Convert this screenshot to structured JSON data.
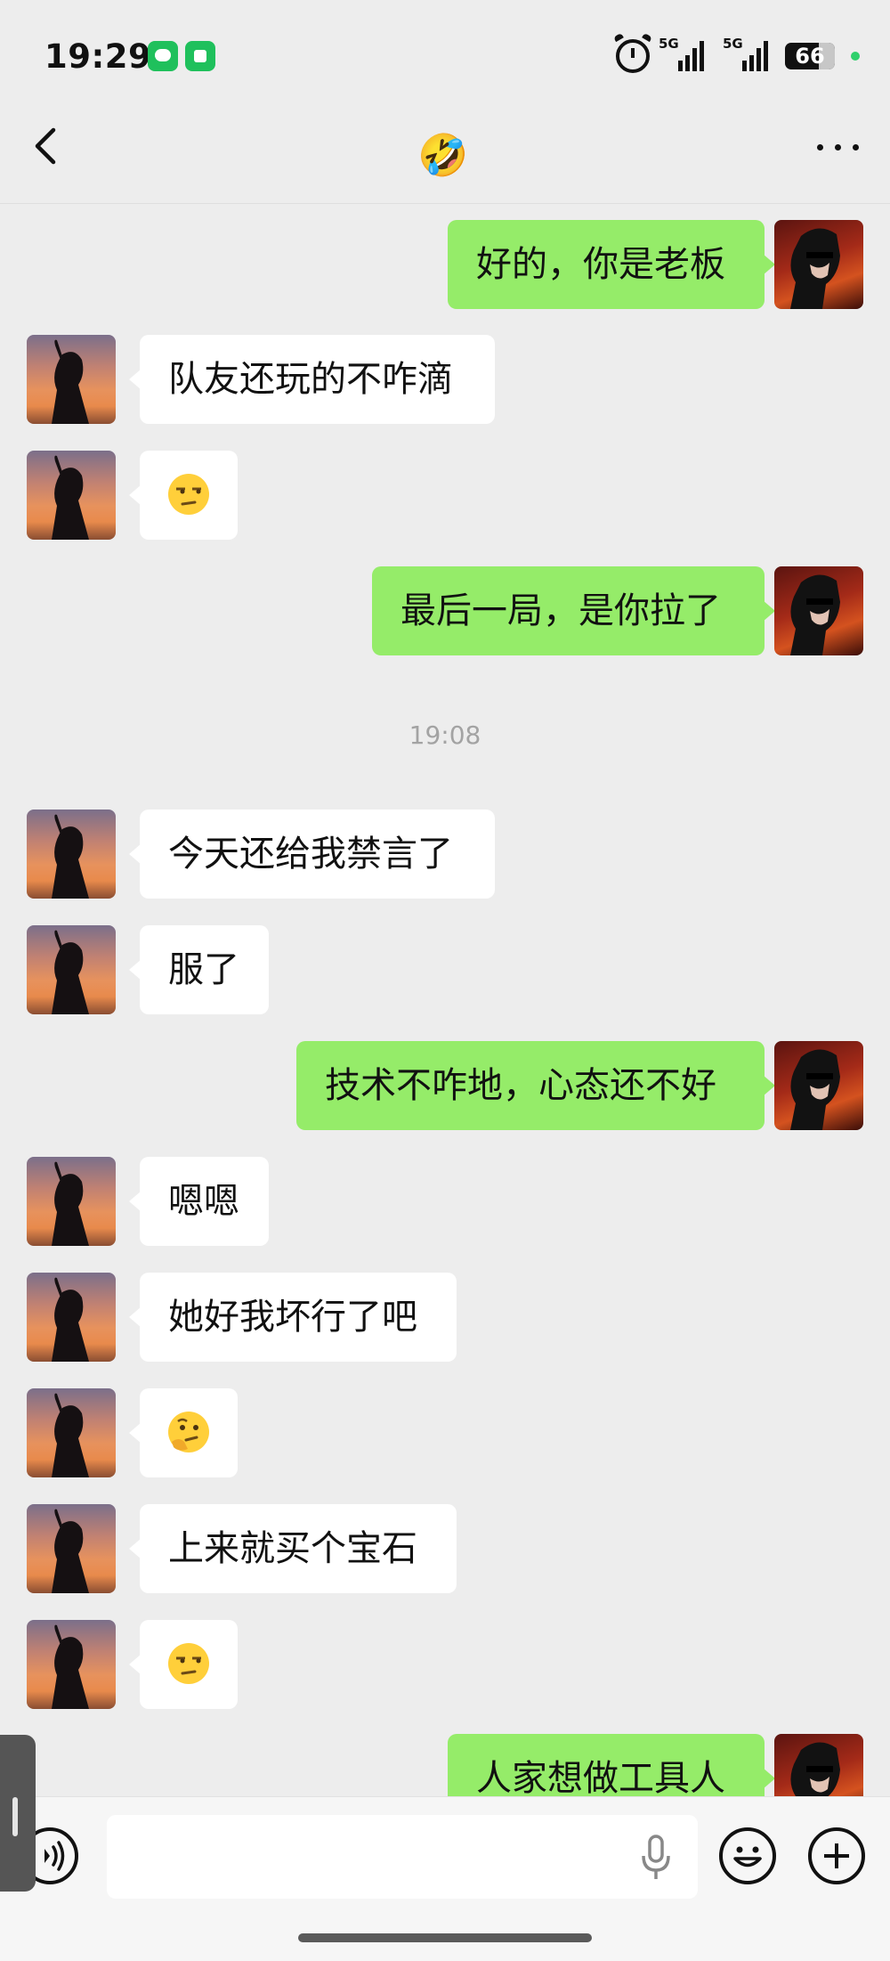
{
  "status_bar": {
    "time": "19:29",
    "signal_1": "5G",
    "signal_2": "5G",
    "battery": "66"
  },
  "header": {
    "title": "🤣",
    "back_icon": "chevron-left-icon",
    "more_icon": "more-dots-icon"
  },
  "chat": {
    "timestamp": "19:08",
    "messages": [
      {
        "from": "me",
        "text": "好的，你是老板"
      },
      {
        "from": "other",
        "text": "队友还玩的不咋滴"
      },
      {
        "from": "other",
        "emoji": "unamused-face"
      },
      {
        "from": "me",
        "text": "最后一局，是你拉了"
      },
      {
        "from": "other",
        "text": "今天还给我禁言了"
      },
      {
        "from": "other",
        "text": "服了"
      },
      {
        "from": "me",
        "text": "技术不咋地，心态还不好"
      },
      {
        "from": "other",
        "text": "嗯嗯"
      },
      {
        "from": "other",
        "text": "她好我坏行了吧"
      },
      {
        "from": "other",
        "emoji": "thinking-face"
      },
      {
        "from": "other",
        "text": "上来就买个宝石"
      },
      {
        "from": "other",
        "emoji": "unamused-face"
      },
      {
        "from": "me",
        "text": "人家想做工具人"
      }
    ]
  },
  "input_bar": {
    "voice_icon": "voice-icon",
    "mic_icon": "microphone-icon",
    "emoji_icon": "smiley-icon",
    "plus_icon": "plus-icon",
    "placeholder": ""
  },
  "colors": {
    "background": "#ededed",
    "outgoing_bubble": "#95ec69",
    "incoming_bubble": "#ffffff",
    "accent": "#1fc05c"
  }
}
